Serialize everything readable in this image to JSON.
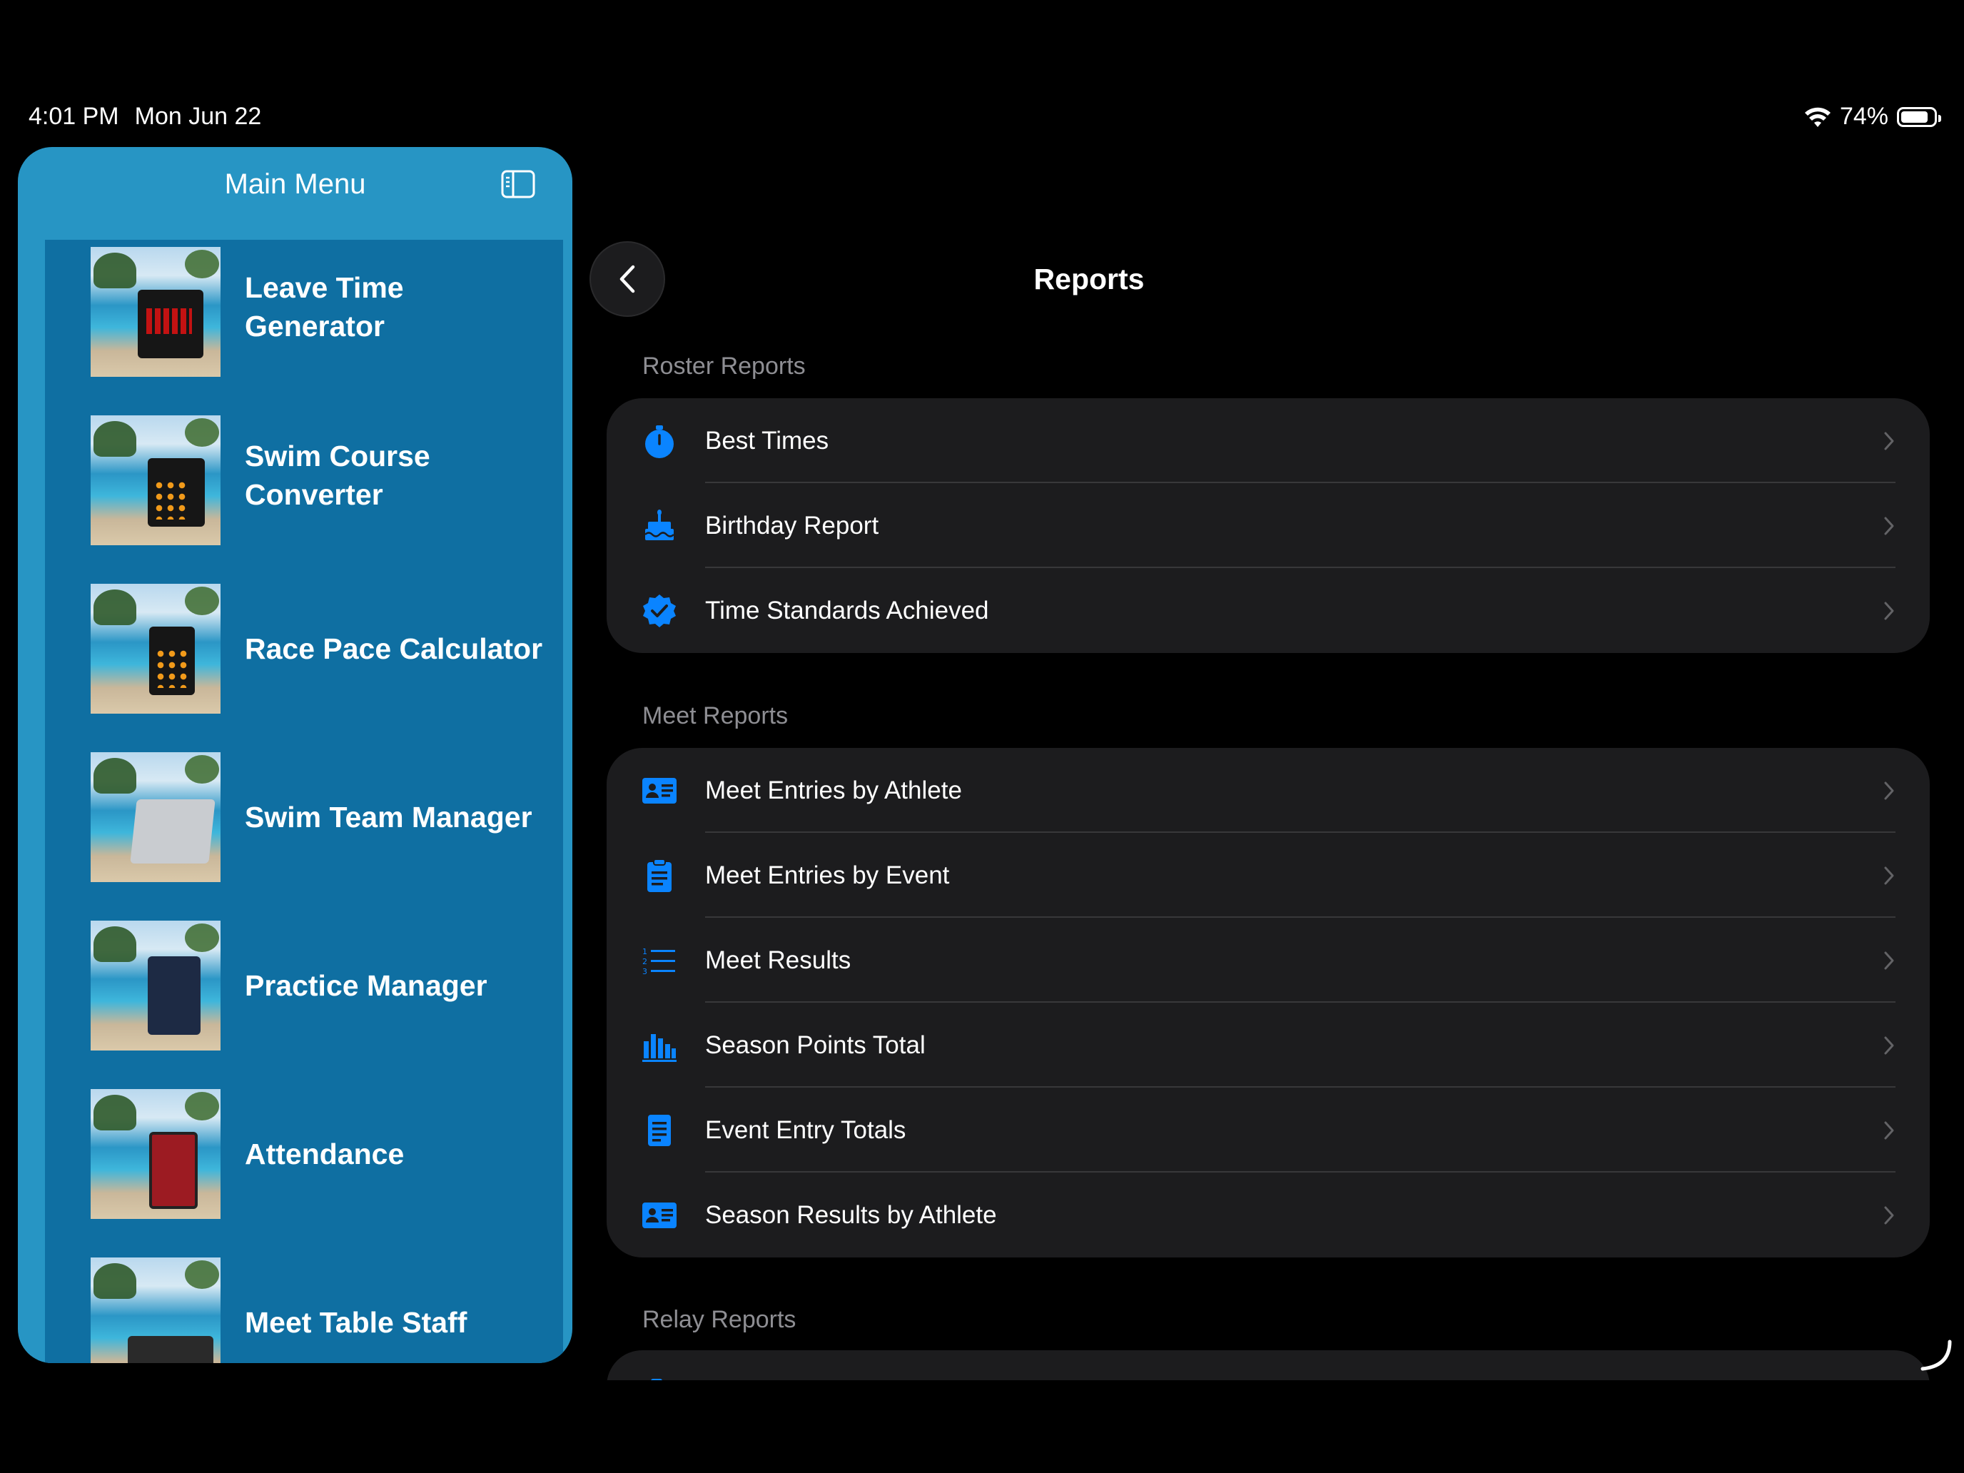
{
  "status_bar": {
    "time": "4:01 PM",
    "date": "Mon Jun 22",
    "battery": "74%"
  },
  "sidebar": {
    "title": "Main Menu",
    "items": [
      {
        "label": "Leave Time Generator"
      },
      {
        "label": "Swim Course Converter"
      },
      {
        "label": "Race Pace Calculator"
      },
      {
        "label": "Swim Team Manager"
      },
      {
        "label": "Practice Manager"
      },
      {
        "label": "Attendance"
      },
      {
        "label": "Meet Table Staff"
      }
    ]
  },
  "main": {
    "title": "Reports",
    "sections": [
      {
        "title": "Roster Reports",
        "rows": [
          {
            "label": "Best Times",
            "icon": "stopwatch-icon"
          },
          {
            "label": "Birthday Report",
            "icon": "birthday-cake-icon"
          },
          {
            "label": "Time Standards Achieved",
            "icon": "checkmark-seal-icon"
          }
        ]
      },
      {
        "title": "Meet Reports",
        "rows": [
          {
            "label": "Meet Entries by Athlete",
            "icon": "person-card-icon"
          },
          {
            "label": "Meet Entries by Event",
            "icon": "clipboard-icon"
          },
          {
            "label": "Meet Results",
            "icon": "numbered-list-icon"
          },
          {
            "label": "Season Points Total",
            "icon": "bar-chart-icon"
          },
          {
            "label": "Event Entry Totals",
            "icon": "document-icon"
          },
          {
            "label": "Season Results by Athlete",
            "icon": "person-card-icon"
          }
        ]
      },
      {
        "title": "Relay Reports",
        "rows": []
      }
    ]
  },
  "colors": {
    "sidebar": "#2795c4",
    "sidebar_list": "#0f6fa2",
    "accent": "#0a84ff",
    "group_bg": "#1c1c1e"
  }
}
